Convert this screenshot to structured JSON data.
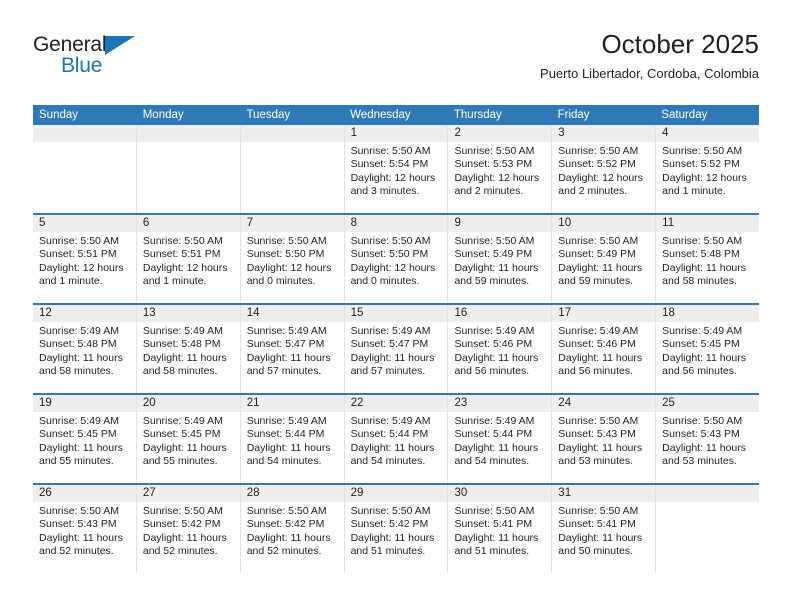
{
  "logo": {
    "word_one": "General",
    "word_two": "Blue",
    "triangle_color": "#1b75bb",
    "text_color": "#231f20"
  },
  "header": {
    "title": "October 2025",
    "subtitle": "Puerto Libertador, Cordoba, Colombia"
  },
  "theme": {
    "header_blue": "#3079b8",
    "daystrip_gray": "#eeeeee",
    "divider_gray": "#e3e3e3"
  },
  "weekdays": [
    "Sunday",
    "Monday",
    "Tuesday",
    "Wednesday",
    "Thursday",
    "Friday",
    "Saturday"
  ],
  "weeks": [
    [
      {
        "day": "",
        "empty": true
      },
      {
        "day": "",
        "empty": true
      },
      {
        "day": "",
        "empty": true
      },
      {
        "day": "1",
        "sunrise": "Sunrise: 5:50 AM",
        "sunset": "Sunset: 5:54 PM",
        "daylight_1": "Daylight: 12 hours",
        "daylight_2": "and 3 minutes."
      },
      {
        "day": "2",
        "sunrise": "Sunrise: 5:50 AM",
        "sunset": "Sunset: 5:53 PM",
        "daylight_1": "Daylight: 12 hours",
        "daylight_2": "and 2 minutes."
      },
      {
        "day": "3",
        "sunrise": "Sunrise: 5:50 AM",
        "sunset": "Sunset: 5:52 PM",
        "daylight_1": "Daylight: 12 hours",
        "daylight_2": "and 2 minutes."
      },
      {
        "day": "4",
        "sunrise": "Sunrise: 5:50 AM",
        "sunset": "Sunset: 5:52 PM",
        "daylight_1": "Daylight: 12 hours",
        "daylight_2": "and 1 minute."
      }
    ],
    [
      {
        "day": "5",
        "sunrise": "Sunrise: 5:50 AM",
        "sunset": "Sunset: 5:51 PM",
        "daylight_1": "Daylight: 12 hours",
        "daylight_2": "and 1 minute."
      },
      {
        "day": "6",
        "sunrise": "Sunrise: 5:50 AM",
        "sunset": "Sunset: 5:51 PM",
        "daylight_1": "Daylight: 12 hours",
        "daylight_2": "and 1 minute."
      },
      {
        "day": "7",
        "sunrise": "Sunrise: 5:50 AM",
        "sunset": "Sunset: 5:50 PM",
        "daylight_1": "Daylight: 12 hours",
        "daylight_2": "and 0 minutes."
      },
      {
        "day": "8",
        "sunrise": "Sunrise: 5:50 AM",
        "sunset": "Sunset: 5:50 PM",
        "daylight_1": "Daylight: 12 hours",
        "daylight_2": "and 0 minutes."
      },
      {
        "day": "9",
        "sunrise": "Sunrise: 5:50 AM",
        "sunset": "Sunset: 5:49 PM",
        "daylight_1": "Daylight: 11 hours",
        "daylight_2": "and 59 minutes."
      },
      {
        "day": "10",
        "sunrise": "Sunrise: 5:50 AM",
        "sunset": "Sunset: 5:49 PM",
        "daylight_1": "Daylight: 11 hours",
        "daylight_2": "and 59 minutes."
      },
      {
        "day": "11",
        "sunrise": "Sunrise: 5:50 AM",
        "sunset": "Sunset: 5:48 PM",
        "daylight_1": "Daylight: 11 hours",
        "daylight_2": "and 58 minutes."
      }
    ],
    [
      {
        "day": "12",
        "sunrise": "Sunrise: 5:49 AM",
        "sunset": "Sunset: 5:48 PM",
        "daylight_1": "Daylight: 11 hours",
        "daylight_2": "and 58 minutes."
      },
      {
        "day": "13",
        "sunrise": "Sunrise: 5:49 AM",
        "sunset": "Sunset: 5:48 PM",
        "daylight_1": "Daylight: 11 hours",
        "daylight_2": "and 58 minutes."
      },
      {
        "day": "14",
        "sunrise": "Sunrise: 5:49 AM",
        "sunset": "Sunset: 5:47 PM",
        "daylight_1": "Daylight: 11 hours",
        "daylight_2": "and 57 minutes."
      },
      {
        "day": "15",
        "sunrise": "Sunrise: 5:49 AM",
        "sunset": "Sunset: 5:47 PM",
        "daylight_1": "Daylight: 11 hours",
        "daylight_2": "and 57 minutes."
      },
      {
        "day": "16",
        "sunrise": "Sunrise: 5:49 AM",
        "sunset": "Sunset: 5:46 PM",
        "daylight_1": "Daylight: 11 hours",
        "daylight_2": "and 56 minutes."
      },
      {
        "day": "17",
        "sunrise": "Sunrise: 5:49 AM",
        "sunset": "Sunset: 5:46 PM",
        "daylight_1": "Daylight: 11 hours",
        "daylight_2": "and 56 minutes."
      },
      {
        "day": "18",
        "sunrise": "Sunrise: 5:49 AM",
        "sunset": "Sunset: 5:45 PM",
        "daylight_1": "Daylight: 11 hours",
        "daylight_2": "and 56 minutes."
      }
    ],
    [
      {
        "day": "19",
        "sunrise": "Sunrise: 5:49 AM",
        "sunset": "Sunset: 5:45 PM",
        "daylight_1": "Daylight: 11 hours",
        "daylight_2": "and 55 minutes."
      },
      {
        "day": "20",
        "sunrise": "Sunrise: 5:49 AM",
        "sunset": "Sunset: 5:45 PM",
        "daylight_1": "Daylight: 11 hours",
        "daylight_2": "and 55 minutes."
      },
      {
        "day": "21",
        "sunrise": "Sunrise: 5:49 AM",
        "sunset": "Sunset: 5:44 PM",
        "daylight_1": "Daylight: 11 hours",
        "daylight_2": "and 54 minutes."
      },
      {
        "day": "22",
        "sunrise": "Sunrise: 5:49 AM",
        "sunset": "Sunset: 5:44 PM",
        "daylight_1": "Daylight: 11 hours",
        "daylight_2": "and 54 minutes."
      },
      {
        "day": "23",
        "sunrise": "Sunrise: 5:49 AM",
        "sunset": "Sunset: 5:44 PM",
        "daylight_1": "Daylight: 11 hours",
        "daylight_2": "and 54 minutes."
      },
      {
        "day": "24",
        "sunrise": "Sunrise: 5:50 AM",
        "sunset": "Sunset: 5:43 PM",
        "daylight_1": "Daylight: 11 hours",
        "daylight_2": "and 53 minutes."
      },
      {
        "day": "25",
        "sunrise": "Sunrise: 5:50 AM",
        "sunset": "Sunset: 5:43 PM",
        "daylight_1": "Daylight: 11 hours",
        "daylight_2": "and 53 minutes."
      }
    ],
    [
      {
        "day": "26",
        "sunrise": "Sunrise: 5:50 AM",
        "sunset": "Sunset: 5:43 PM",
        "daylight_1": "Daylight: 11 hours",
        "daylight_2": "and 52 minutes."
      },
      {
        "day": "27",
        "sunrise": "Sunrise: 5:50 AM",
        "sunset": "Sunset: 5:42 PM",
        "daylight_1": "Daylight: 11 hours",
        "daylight_2": "and 52 minutes."
      },
      {
        "day": "28",
        "sunrise": "Sunrise: 5:50 AM",
        "sunset": "Sunset: 5:42 PM",
        "daylight_1": "Daylight: 11 hours",
        "daylight_2": "and 52 minutes."
      },
      {
        "day": "29",
        "sunrise": "Sunrise: 5:50 AM",
        "sunset": "Sunset: 5:42 PM",
        "daylight_1": "Daylight: 11 hours",
        "daylight_2": "and 51 minutes."
      },
      {
        "day": "30",
        "sunrise": "Sunrise: 5:50 AM",
        "sunset": "Sunset: 5:41 PM",
        "daylight_1": "Daylight: 11 hours",
        "daylight_2": "and 51 minutes."
      },
      {
        "day": "31",
        "sunrise": "Sunrise: 5:50 AM",
        "sunset": "Sunset: 5:41 PM",
        "daylight_1": "Daylight: 11 hours",
        "daylight_2": "and 50 minutes."
      },
      {
        "day": "",
        "empty": true
      }
    ]
  ]
}
